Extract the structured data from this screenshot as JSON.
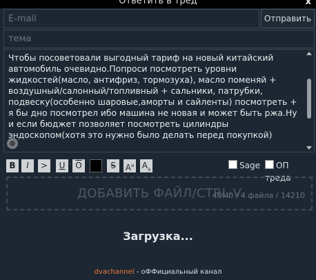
{
  "window": {
    "title": "Ответить в тред",
    "close_label": "x"
  },
  "form": {
    "email_placeholder": "E-mail",
    "send_label": "Отправить",
    "subject_placeholder": "тема",
    "comment_text": "Чтобы посоветовали выгодный тариф на новый китайский автомобиль очевидно.Попроси посмотреть уровни жидкостей(масло, антифриз, тормозуха), масло поменяй + воздушный/салонный/топливный + сальники, патрубки, подвеску(особенно шаровые,аморты и сайленты) посмотреть + я бы дно посмотрел ибо машина не новая и может быть ржа.Ну и если бюджет позволяет посмотреть цилиндры эндоскопом(хотя это нужно было делать перед покупкой)",
    "counter": "40Мб / 4 файла / 14210"
  },
  "toolbar": {
    "buttons": [
      {
        "label": "B",
        "icon": "bold-icon"
      },
      {
        "label": "I",
        "icon": "italic-icon"
      },
      {
        "label": ">",
        "icon": "quote-icon"
      },
      {
        "label": "U",
        "icon": "underline-icon"
      },
      {
        "label": "O",
        "icon": "overline-icon"
      },
      {
        "label": "",
        "icon": "spoiler-icon"
      },
      {
        "label": "S",
        "icon": "strikethrough-icon"
      },
      {
        "label": "A",
        "icon": "superscript-icon"
      },
      {
        "label": "A",
        "icon": "subscript-icon"
      }
    ],
    "sage_label": "Sage",
    "op_label": "ОП треда"
  },
  "dropzone": {
    "label": "ДОБАВИТЬ ФАЙЛ/CTRL-V"
  },
  "loading": {
    "text": "Загрузка..."
  },
  "footer": {
    "link": "dvachannel",
    "text": " - оФФициальный канал"
  }
}
